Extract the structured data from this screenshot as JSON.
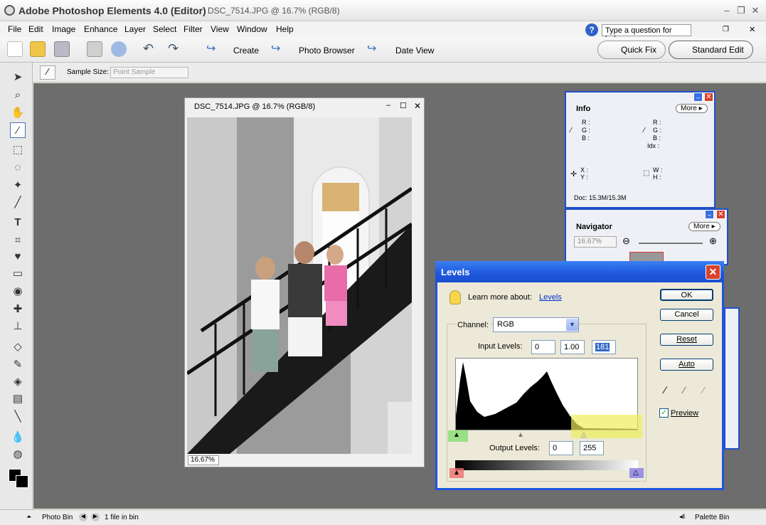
{
  "window": {
    "title": "Adobe Photoshop Elements 4.0 (Editor)",
    "doc_info": "DSC_7514.JPG @ 16.7% (RGB/8)"
  },
  "menu": [
    "File",
    "Edit",
    "Image",
    "Enhance",
    "Layer",
    "Select",
    "Filter",
    "View",
    "Window",
    "Help"
  ],
  "help_placeholder": "Type a question for help",
  "shortcuts": {
    "create": "Create",
    "photo_browser": "Photo Browser",
    "date_view": "Date View",
    "quick_fix": "Quick Fix",
    "standard_edit": "Standard Edit"
  },
  "options": {
    "sample_size_label": "Sample Size:",
    "sample_size_value": "Point Sample"
  },
  "document": {
    "title": "DSC_7514.JPG @ 16.7% (RGB/8)",
    "zoom": "16.67%"
  },
  "info_panel": {
    "tab": "Info",
    "more": "More",
    "rgb_left": [
      "R :",
      "G :",
      "B :"
    ],
    "rgb_right": [
      "R :",
      "G :",
      "B :",
      "Idx :"
    ],
    "xy": [
      "X :",
      "Y :"
    ],
    "wh": [
      "W :",
      "H :"
    ],
    "doc": "Doc: 15.3M/15.3M"
  },
  "navigator_panel": {
    "tab": "Navigator",
    "more": "More",
    "zoom": "16.67%"
  },
  "levels": {
    "title": "Levels",
    "learn_more": "Learn more about:",
    "learn_link": "Levels",
    "channel_label": "Channel:",
    "channel_value": "RGB",
    "input_label": "Input Levels:",
    "input_values": [
      "0",
      "1.00",
      "181"
    ],
    "output_label": "Output Levels:",
    "output_values": [
      "0",
      "255"
    ],
    "buttons": {
      "ok": "OK",
      "cancel": "Cancel",
      "reset": "Reset",
      "auto": "Auto"
    },
    "preview": "Preview",
    "preview_checked": true
  },
  "status": {
    "photo_bin": "Photo Bin",
    "files": "1 file in bin",
    "palette_bin": "Palette Bin"
  }
}
